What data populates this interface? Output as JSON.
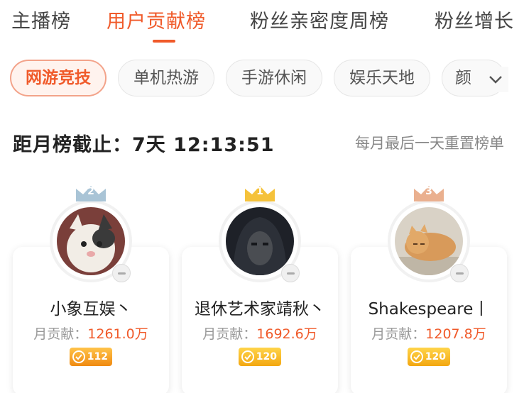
{
  "tabs": [
    {
      "label": "主播榜"
    },
    {
      "label": "用户贡献榜"
    },
    {
      "label": "粉丝亲密度周榜"
    },
    {
      "label": "粉丝增长"
    }
  ],
  "chips": [
    {
      "label": "网游竞技"
    },
    {
      "label": "单机热游"
    },
    {
      "label": "手游休闲"
    },
    {
      "label": "娱乐天地"
    },
    {
      "label": "颜"
    }
  ],
  "countdown": {
    "text": "距月榜截止：7天 12:13:51"
  },
  "reset_note": "每月最后一天重置榜单",
  "contrib_label": "月贡献：",
  "ranks": [
    {
      "rank": "2",
      "name": "小象互娱丶",
      "contribution": "1261.0万",
      "level": "112",
      "crown_color": "#a9c4d6"
    },
    {
      "rank": "1",
      "name": "退休艺术家靖秋丶",
      "contribution": "1692.6万",
      "level": "120",
      "crown_color": "#f5c23b"
    },
    {
      "rank": "3",
      "name": "Shakespeare丨",
      "contribution": "1207.8万",
      "level": "120",
      "crown_color": "#eab08f"
    }
  ],
  "colors": {
    "accent": "#f05a2a"
  },
  "icons": {
    "more": "chevron-down-icon",
    "minus": "minus-icon",
    "crown": "crown-icon",
    "level": "level-badge-icon"
  }
}
